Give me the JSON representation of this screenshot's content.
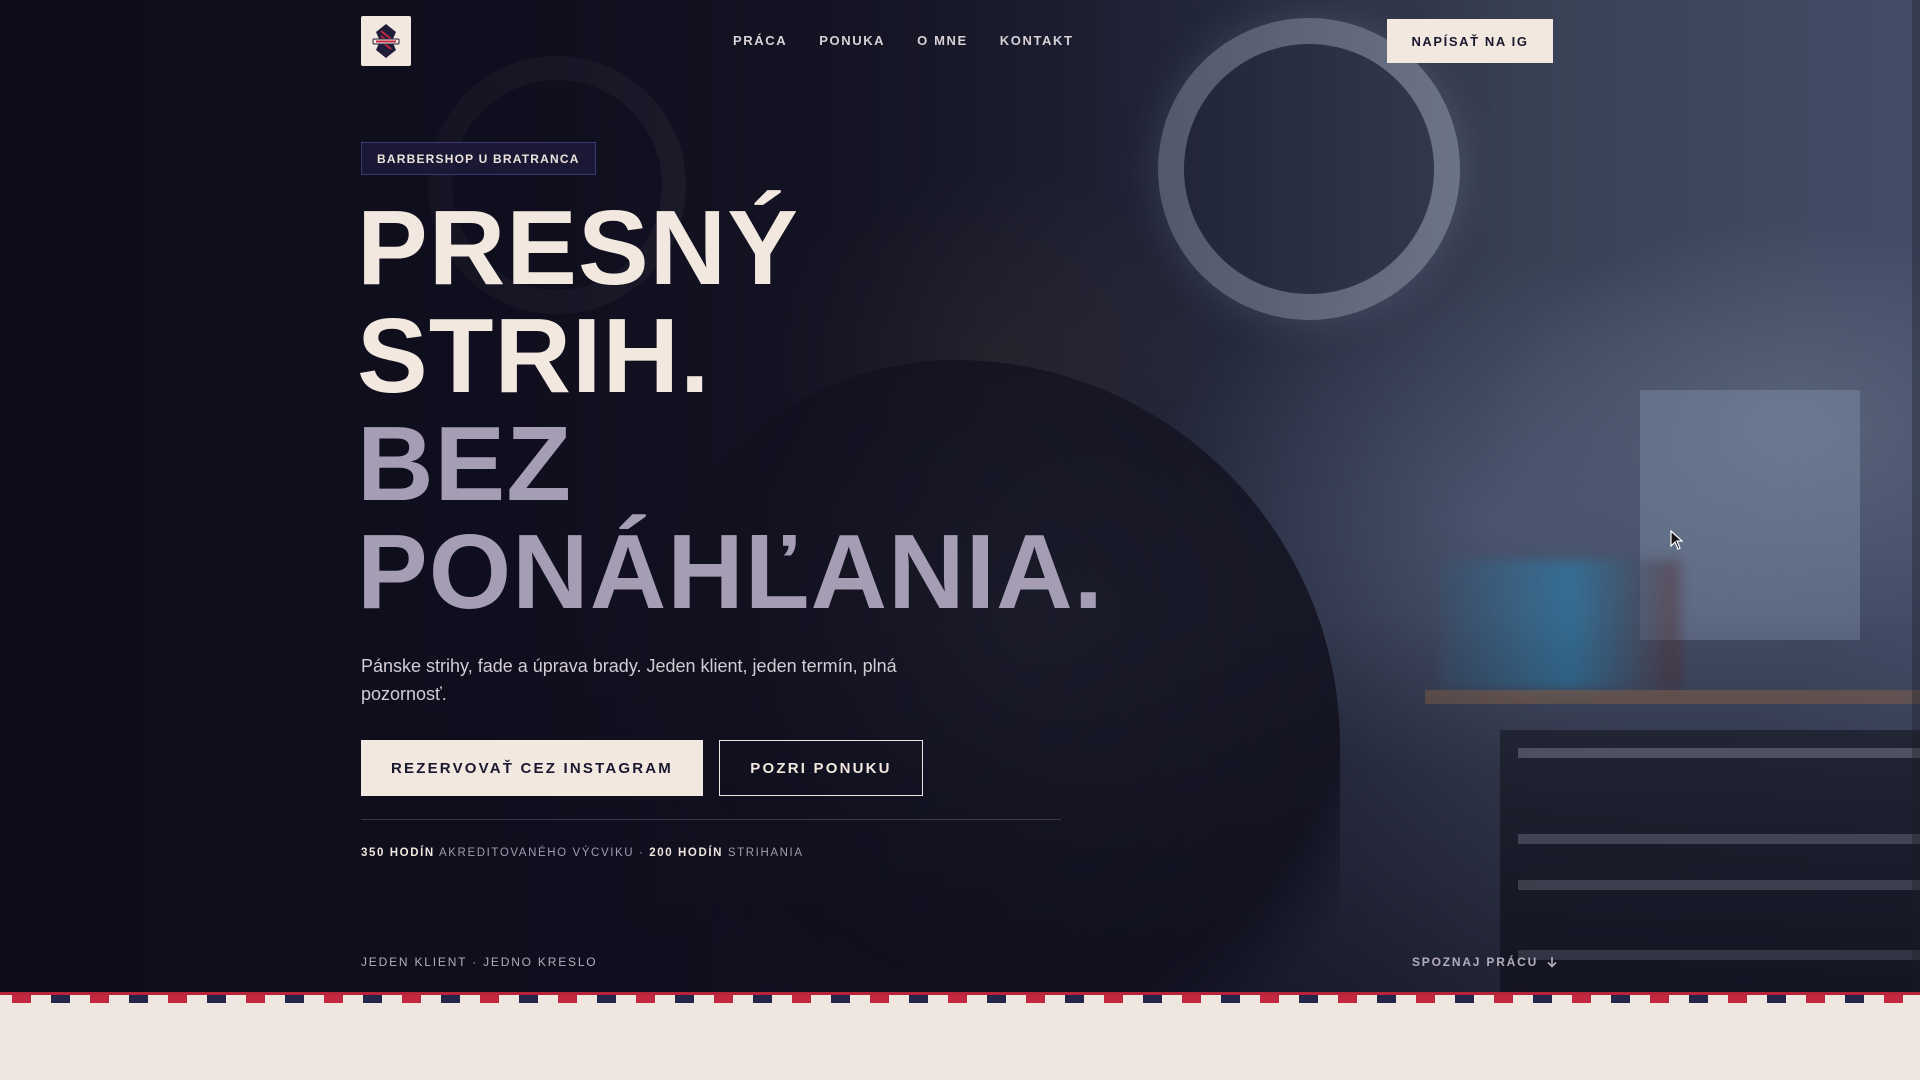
{
  "nav": {
    "logo_label": "Barbershop logo",
    "links": [
      "PRÁCA",
      "PONUKA",
      "O MNE",
      "KONTAKT"
    ],
    "cta": "NAPÍSAŤ NA IG"
  },
  "hero": {
    "badge": "BARBERSHOP U BRATRANCA",
    "headline": [
      "PRESNÝ",
      "STRIH.",
      "BEZ",
      "PONÁHĽANIA."
    ],
    "lead": "Pánske strihy, fade a úprava brady. Jeden klient, jeden termín, plná pozornosť.",
    "primary_button": "REZERVOVAŤ CEZ INSTAGRAM",
    "secondary_button": "POZRI PONUKU",
    "stats": {
      "hours_1": "350 HODÍN",
      "label_1": "AKREDITOVANÉHO VÝCVIKU",
      "separator": "·",
      "hours_2": "200 HODÍN",
      "label_2": "STRIHANIA"
    },
    "footer_left": "JEDEN KLIENT · JEDNO KRESLO",
    "footer_right": "SPOZNAJ PRÁCU"
  },
  "colors": {
    "background": "#0f0e1d",
    "cream": "#f2e8df",
    "muted_headline": "#a59db3",
    "stripe_red": "#c42840",
    "stripe_navy": "#242649"
  },
  "icons": {
    "logo": "barber-pole-emblem-icon",
    "scroll": "arrow-down-icon",
    "cursor": "mouse-pointer-icon"
  }
}
